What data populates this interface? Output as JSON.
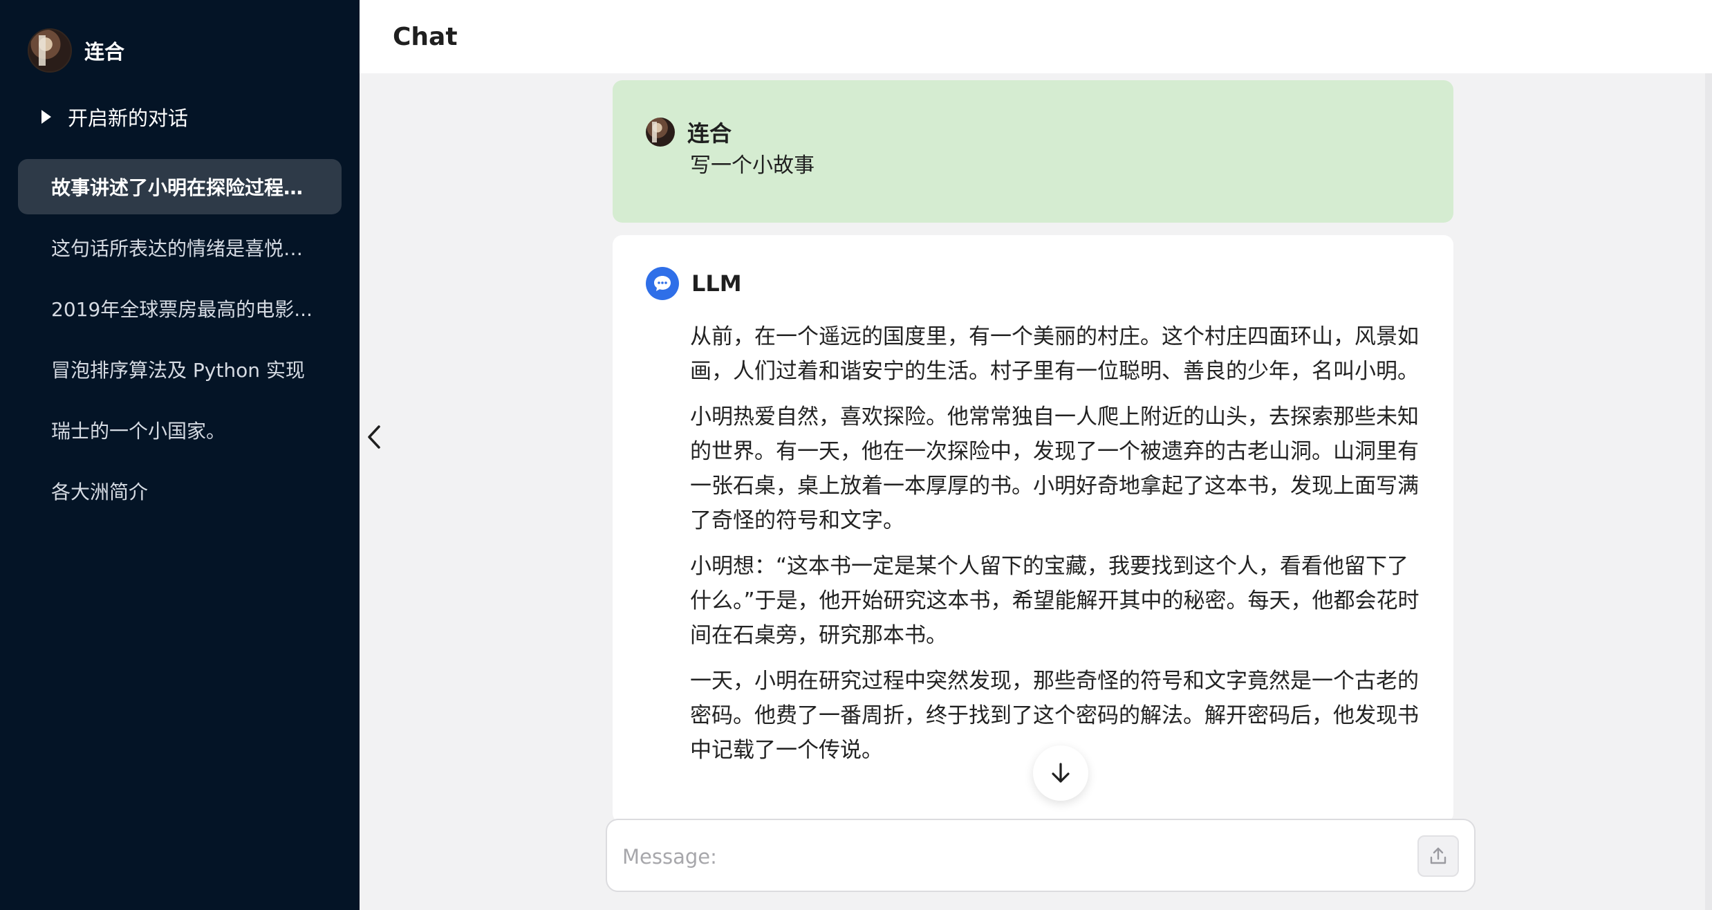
{
  "sidebar": {
    "user_name": "连合",
    "new_chat_label": "开启新的对话",
    "history": [
      {
        "label": "故事讲述了小明在探险过程中...",
        "active": true
      },
      {
        "label": "这句话所表达的情绪是喜悦和...",
        "active": false
      },
      {
        "label": "2019年全球票房最高的电影...",
        "active": false
      },
      {
        "label": "冒泡排序算法及 Python 实现",
        "active": false
      },
      {
        "label": "瑞士的一个小国家。",
        "active": false
      },
      {
        "label": "各大洲简介",
        "active": false
      }
    ]
  },
  "header": {
    "title": "Chat"
  },
  "messages": {
    "user": {
      "author": "连合",
      "text": "写一个小故事"
    },
    "llm": {
      "author": "LLM",
      "paragraphs": [
        "从前，在一个遥远的国度里，有一个美丽的村庄。这个村庄四面环山，风景如画，人们过着和谐安宁的生活。村子里有一位聪明、善良的少年，名叫小明。",
        "小明热爱自然，喜欢探险。他常常独自一人爬上附近的山头，去探索那些未知的世界。有一天，他在一次探险中，发现了一个被遗弃的古老山洞。山洞里有一张石桌，桌上放着一本厚厚的书。小明好奇地拿起了这本书，发现上面写满了奇怪的符号和文字。",
        "小明想：“这本书一定是某个人留下的宝藏，我要找到这个人，看看他留下了什么。”于是，他开始研究这本书，希望能解开其中的秘密。每天，他都会花时间在石桌旁，研究那本书。",
        "一天，小明在研究过程中突然发现，那些奇怪的符号和文字竟然是一个古老的密码。他费了一番周折，终于找到了这个密码的解法。解开密码后，他发现书中记载了一个传说。"
      ]
    }
  },
  "composer": {
    "placeholder": "Message:"
  },
  "icons": {
    "collapse": "chevron-left-icon",
    "scroll_down": "arrow-down-icon",
    "send": "upload-icon",
    "llm_avatar": "chat-bubble-icon"
  },
  "colors": {
    "sidebar_bg": "#041426",
    "active_item_bg": "#2e3a48",
    "user_msg_bg": "#d5ecd1",
    "llm_icon_bg": "#2f6fe8"
  }
}
